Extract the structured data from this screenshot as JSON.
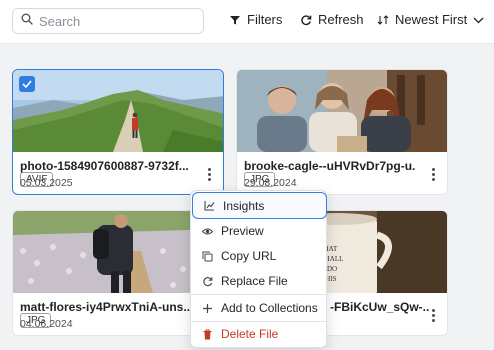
{
  "toolbar": {
    "search": {
      "placeholder": "Search",
      "value": ""
    },
    "filters_label": "Filters",
    "refresh_label": "Refresh",
    "sort_label": "Newest First"
  },
  "cards": [
    {
      "name": "photo-1584907600887-9732f...",
      "date": "05.03.2025",
      "badge": "AVIF",
      "selected": true
    },
    {
      "name": "brooke-cagle--uHVRvDr7pg-u...",
      "date": "29.08.2024",
      "badge": "JPG",
      "selected": false
    },
    {
      "name": "matt-flores-iy4PrwxTniA-uns...",
      "date": "04.06.2024",
      "badge": "JPG",
      "selected": false
    },
    {
      "name": "-FBiKcUw_sQw-...",
      "date": "",
      "badge": "",
      "selected": false
    }
  ],
  "mug_text": [
    "WHAT",
    "OD SHALL",
    "DO",
    "THIS"
  ],
  "context_menu": {
    "items": [
      {
        "label": "Insights",
        "icon": "chart-icon",
        "active": true
      },
      {
        "label": "Preview",
        "icon": "eye-icon"
      },
      {
        "label": "Copy URL",
        "icon": "copy-icon"
      },
      {
        "label": "Replace File",
        "icon": "refresh-icon"
      },
      {
        "label": "Add to Collections",
        "icon": "plus-icon"
      },
      {
        "label": "Delete File",
        "icon": "trash-icon",
        "danger": true
      }
    ]
  },
  "colors": {
    "accent": "#2f7de1",
    "danger": "#c43a27"
  }
}
